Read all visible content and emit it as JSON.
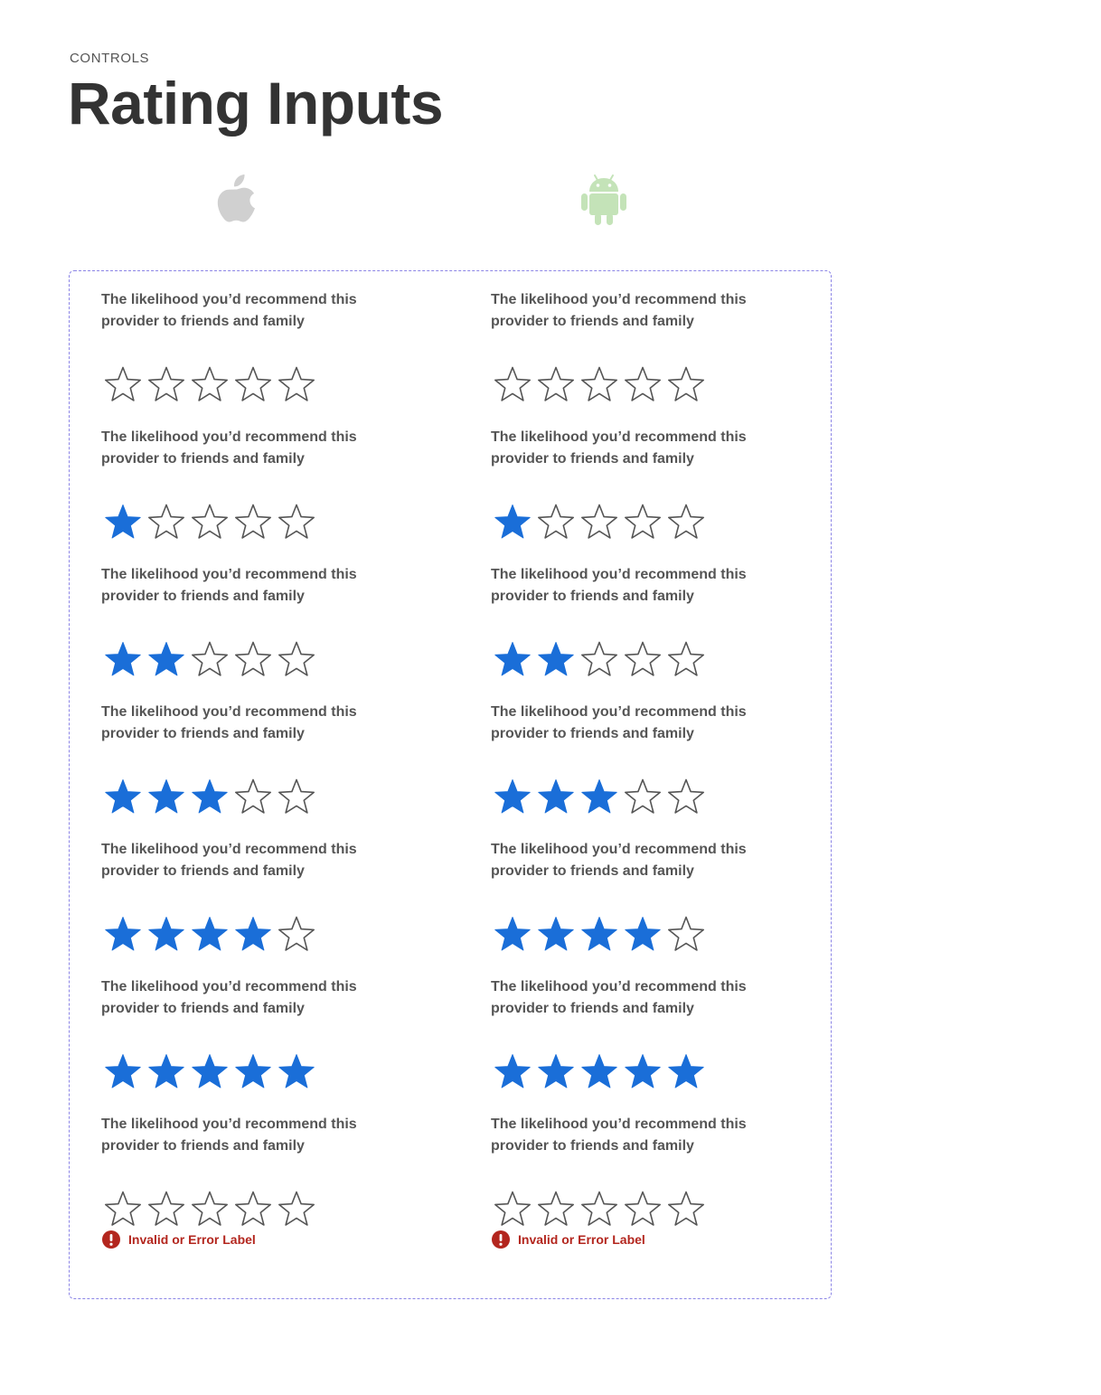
{
  "header": {
    "eyebrow": "CONTROLS",
    "title": "Rating Inputs"
  },
  "platforms": [
    {
      "name": "ios",
      "icon": "apple-logo-icon",
      "color": "#d0d0d0"
    },
    {
      "name": "android",
      "icon": "android-logo-icon",
      "color": "#c4e3b8"
    }
  ],
  "colors": {
    "filled_star": "#1a6ed8",
    "empty_star_stroke": "#555555",
    "error": "#b3261e",
    "panel_border": "#8b84e6"
  },
  "ios": {
    "ratings": [
      {
        "label": "The likelihood you’d recommend this provider to friends and family",
        "value": 0
      },
      {
        "label": "The likelihood you’d recommend this provider to friends and family",
        "value": 1
      },
      {
        "label": "The likelihood you’d recommend this provider to friends and family",
        "value": 2
      },
      {
        "label": "The likelihood you’d recommend this provider to friends and family",
        "value": 3
      },
      {
        "label": "The likelihood you’d recommend this provider to friends and family",
        "value": 4
      },
      {
        "label": "The likelihood you’d recommend this provider to friends and family",
        "value": 5
      },
      {
        "label": "The likelihood you’d recommend this provider to friends and family",
        "value": 0,
        "error": "Invalid or Error Label"
      }
    ]
  },
  "android": {
    "ratings": [
      {
        "label": "The likelihood you’d recommend this provider to friends and family",
        "value": 0
      },
      {
        "label": "The likelihood you’d recommend this provider to friends and family",
        "value": 1
      },
      {
        "label": "The likelihood you’d recommend this provider to friends and family",
        "value": 2
      },
      {
        "label": "The likelihood you’d recommend this provider to friends and family",
        "value": 3
      },
      {
        "label": "The likelihood you’d recommend this provider to friends and family",
        "value": 4
      },
      {
        "label": "The likelihood you’d recommend this provider to friends and family",
        "value": 5
      },
      {
        "label": "The likelihood you’d recommend this provider to friends and family",
        "value": 0,
        "error": "Invalid or Error Label"
      }
    ]
  },
  "max_stars": 5
}
